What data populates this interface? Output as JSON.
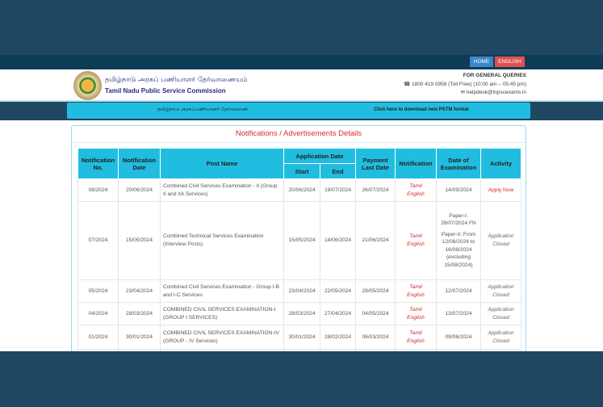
{
  "nav": {
    "home": "HOME",
    "english": "ENGLISH"
  },
  "header": {
    "tamil_name": "தமிழ்நாடு அரசுப் பணியாளர் தேர்வாணையம்",
    "english_name": "Tamil Nadu Public Service Commission",
    "queries_label": "FOR GENERAL QUERIES",
    "phone": "1800 419 0958 (Toll Free)  (10:00 am – 05:45 pm)",
    "email": "helpdesk@tnpscexams.in"
  },
  "bar": {
    "tamil": "தமிழ்நாடு அரசுப்பணியாளர் தேர்வாணை",
    "pstm": "Click here to download new PSTM format"
  },
  "section_title": "Notifications / Advertisements Details",
  "table": {
    "headers": {
      "no": "Notification No.",
      "date": "Notification Date",
      "post": "Post Name",
      "app": "Application Date",
      "start": "Start",
      "end": "End",
      "pay": "Payment Last Date",
      "notif": "Notification",
      "exam": "Date of Examination",
      "activity": "Activity"
    },
    "rows": [
      {
        "no": "08/2024",
        "date": "20/06/2024",
        "post": "Combined Civil Services Examination - II (Group II and IIA Services)",
        "start": "20/06/2024",
        "end": "19/07/2024",
        "pay": "26/07/2024",
        "tamil": "Tamil",
        "english": "English",
        "exam": "14/09/2024",
        "activity": "Apply Now"
      },
      {
        "no": "07/2024",
        "date": "15/05/2024",
        "post": "Combined Technical Services Examination (Interview Posts)",
        "start": "15/05/2024",
        "end": "14/06/2024",
        "pay": "21/06/2024",
        "tamil": "Tamil",
        "english": "English",
        "exam": "Paper-I: 28/07/2024 FN",
        "exam2": "Paper-II: From 12/08/2024 to 16/08/2024 (excluding 15/08/2024)",
        "activity": "Application Closed"
      },
      {
        "no": "05/2024",
        "date": "23/04/2024",
        "post": "Combined Civil Services Examination - Group I-B and I-C Services",
        "start": "23/04/2024",
        "end": "22/05/2024",
        "pay": "29/05/2024",
        "tamil": "Tamil",
        "english": "English",
        "exam": "12/07/2024",
        "activity": "Application Closed"
      },
      {
        "no": "04/2024",
        "date": "28/03/2024",
        "post": "COMBINED CIVIL SERVICES EXAMINATION-I (GROUP I SERVICES)",
        "start": "28/03/2024",
        "end": "27/04/2024",
        "pay": "04/05/2024",
        "tamil": "Tamil",
        "english": "English",
        "exam": "13/07/2024",
        "activity": "Application Closed"
      },
      {
        "no": "01/2024",
        "date": "30/01/2024",
        "post": "COMBINED CIVIL SERVICES EXAMINATION-IV (GROUP - IV Services)",
        "start": "30/01/2024",
        "end": "28/02/2024",
        "pay": "06/03/2024",
        "tamil": "Tamil",
        "english": "English",
        "exam": "09/06/2024",
        "activity": "Application Closed"
      }
    ]
  }
}
